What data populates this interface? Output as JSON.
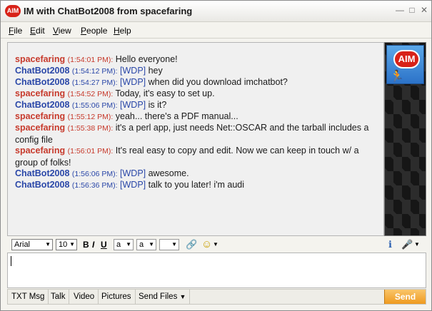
{
  "window": {
    "title": "IM with ChatBot2008 from spacefaring",
    "logo_text": "AIM",
    "minimize_glyph": "—",
    "maximize_glyph": "□",
    "close_glyph": "✕"
  },
  "menu": {
    "items": [
      "File",
      "Edit",
      "View",
      "People",
      "Help"
    ]
  },
  "messages": [
    {
      "sender": "spacefaring",
      "time": "(1:54:01 PM):",
      "tag": "",
      "text": "Hello everyone!"
    },
    {
      "sender": "ChatBot2008",
      "time": "(1:54:12 PM):",
      "tag": "[WDP]",
      "text": "hey"
    },
    {
      "sender": "ChatBot2008",
      "time": "(1:54:27 PM):",
      "tag": "[WDP]",
      "text": "when did you download imchatbot?"
    },
    {
      "sender": "spacefaring",
      "time": "(1:54:52 PM):",
      "tag": "",
      "text": "Today, it's easy to set up."
    },
    {
      "sender": "ChatBot2008",
      "time": "(1:55:06 PM):",
      "tag": "[WDP]",
      "text": "is it?"
    },
    {
      "sender": "spacefaring",
      "time": "(1:55:12 PM):",
      "tag": "",
      "text": "yeah... there's a PDF manual..."
    },
    {
      "sender": "spacefaring",
      "time": "(1:55:38 PM):",
      "tag": "",
      "text": "it's a perl app, just needs Net::OSCAR and the tarball includes a config file"
    },
    {
      "sender": "spacefaring",
      "time": "(1:56:01 PM):",
      "tag": "",
      "text": "It's real easy to copy and edit.  Now we can keep in touch w/ a group of folks!"
    },
    {
      "sender": "ChatBot2008",
      "time": "(1:56:06 PM):",
      "tag": "[WDP]",
      "text": "awesome."
    },
    {
      "sender": "ChatBot2008",
      "time": "(1:56:36 PM):",
      "tag": "[WDP]",
      "text": "talk to you later! i'm audi"
    }
  ],
  "side": {
    "logo_text": "AIM",
    "runner_glyph": "🏃"
  },
  "format": {
    "font": "Arial",
    "size": "10",
    "bold": "B",
    "italic": "I",
    "underline": "U",
    "text_color": "a",
    "bg_color": "a",
    "link_glyph": "🔗",
    "smiley_glyph": "☺",
    "info_glyph": "ℹ",
    "mic_glyph": "🎤"
  },
  "bottom": {
    "buttons": [
      "TXT Msg",
      "Talk",
      "Video",
      "Pictures",
      "Send Files"
    ],
    "send": "Send"
  },
  "colors": {
    "spacefaring": "#c73a2c",
    "chatbot": "#2a47a8",
    "send": "#ef9a1f",
    "aim_red": "#d82218"
  }
}
